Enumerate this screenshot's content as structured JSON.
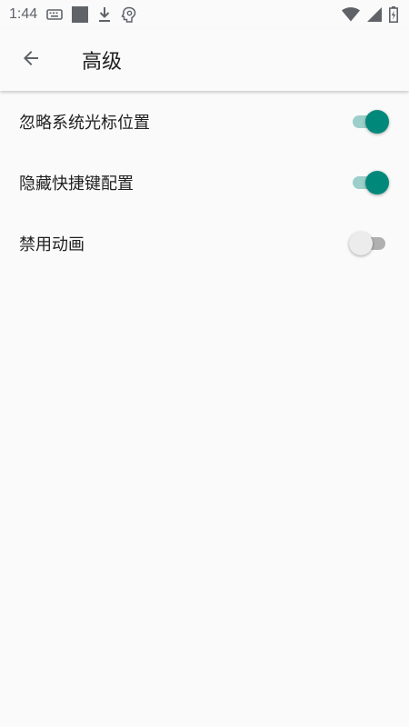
{
  "status_bar": {
    "time": "1:44",
    "icons": [
      "keyboard-icon",
      "square-icon",
      "download-icon",
      "brain-icon",
      "wifi-icon",
      "signal-icon",
      "battery-icon"
    ]
  },
  "app_bar": {
    "back_icon": "arrow-back-icon",
    "title": "高级"
  },
  "settings": {
    "items": [
      {
        "label": "忽略系统光标位置",
        "enabled": true
      },
      {
        "label": "隐藏快捷键配置",
        "enabled": true
      },
      {
        "label": "禁用动画",
        "enabled": false
      }
    ]
  },
  "colors": {
    "accent": "#00897b",
    "accent_track": "#9ccfca",
    "background": "#fafafa"
  }
}
